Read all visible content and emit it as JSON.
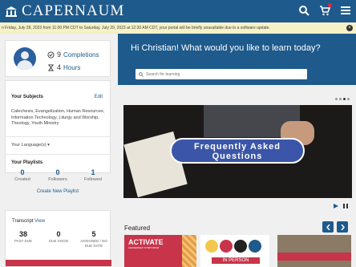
{
  "header": {
    "brand": "CAPERNAUM",
    "icons": [
      "search-icon",
      "cart-icon",
      "menu-icon"
    ],
    "color": "#1e5a8c"
  },
  "banner": {
    "text": "n Friday, July 28, 2023 from 11:00 PM CDT to Saturday, July 29, 2023 at 12:30 AM CDT, your portal will be briefly unavailable due to a software update."
  },
  "profile": {
    "completions_count": "9",
    "completions_label": "Completions",
    "hours_count": "4",
    "hours_label": "Hours"
  },
  "subjects": {
    "title": "Your Subjects",
    "edit": "Edit",
    "list": "Catechesis, Evangelization, Human Resources, Information Technology, Liturgy and Worship, Theology, Youth Ministry"
  },
  "languages": {
    "label": "Your Language(s)"
  },
  "playlists": {
    "title": "Your Playlists",
    "stats": [
      {
        "value": "0",
        "label": "Created"
      },
      {
        "value": "0",
        "label": "Followers"
      },
      {
        "value": "1",
        "label": "Followed"
      }
    ],
    "create": "Create New Playlist"
  },
  "transcript": {
    "title": "Transcript",
    "view": "View",
    "stats": [
      {
        "value": "38",
        "label": "PAST DUE"
      },
      {
        "value": "0",
        "label": "DUE SOON"
      },
      {
        "value": "5",
        "label": "ASSIGNED / NO DUE DATE"
      }
    ]
  },
  "hero": {
    "greeting": "Hi Christian! What would you like to learn today?",
    "search_placeholder": "Search for learning"
  },
  "carousel": {
    "slide_text": "Frequently Asked Questions",
    "slide_count": 4,
    "active_slide": 3
  },
  "featured": {
    "title": "Featured",
    "items": [
      {
        "title": "ACTIVATE",
        "subtitle": "LEADERSHIP SYMPOSIUM"
      },
      {
        "title": "IN PERSON"
      },
      {
        "title": ""
      }
    ]
  },
  "colors": {
    "primary": "#1e5a8c",
    "accent": "#c8344a",
    "banner": "#f6f1c6"
  }
}
